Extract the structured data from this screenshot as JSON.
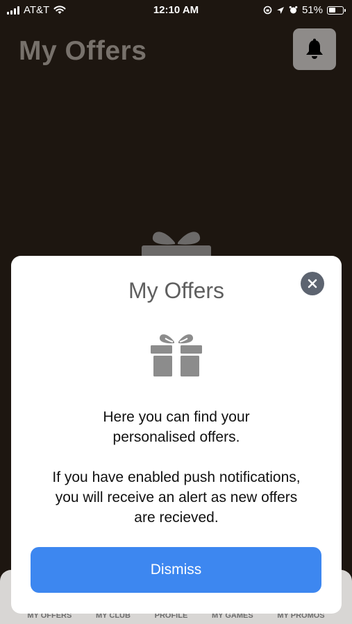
{
  "status_bar": {
    "carrier": "AT&T",
    "time": "12:10 AM",
    "battery": "51%",
    "battery_level": 51,
    "icons": [
      "signal-icon",
      "wifi-icon",
      "rotation-lock-icon",
      "location-icon",
      "alarm-icon",
      "battery-icon"
    ]
  },
  "header": {
    "title": "My Offers",
    "bell_icon": "bell-icon"
  },
  "background": {
    "icon": "gift-icon"
  },
  "tab_bar": {
    "tabs": [
      {
        "label": "MY OFFERS"
      },
      {
        "label": "MY CLUB"
      },
      {
        "label": "PROFILE"
      },
      {
        "label": "MY GAMES"
      },
      {
        "label": "MY PROMOS"
      }
    ]
  },
  "modal": {
    "title": "My Offers",
    "close_icon": "close-icon",
    "icon": "gift-icon",
    "text_1_line_1": "Here you can find your",
    "text_1_line_2": "personalised offers.",
    "text_2_line_1": "If you have enabled push notifications,",
    "text_2_line_2": "you will receive an alert as new offers",
    "text_2_line_3": "are recieved.",
    "dismiss_label": "Dismiss"
  },
  "colors": {
    "background": "#1d1610",
    "accent": "#3d87f0",
    "icon_gray": "#8c8c8c",
    "close_button": "#5d6470"
  }
}
